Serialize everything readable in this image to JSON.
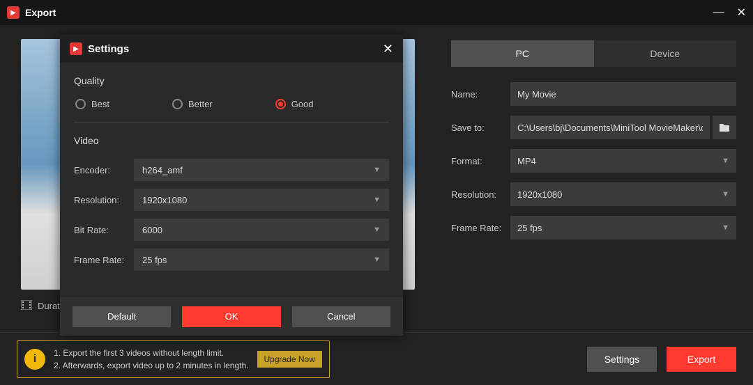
{
  "export_window": {
    "title": "Export",
    "tabs": {
      "pc": "PC",
      "device": "Device"
    },
    "fields": {
      "name_label": "Name:",
      "name_value": "My Movie",
      "save_to_label": "Save to:",
      "save_to_value": "C:\\Users\\bj\\Documents\\MiniTool MovieMaker\\outp",
      "format_label": "Format:",
      "format_value": "MP4",
      "resolution_label": "Resolution:",
      "resolution_value": "1920x1080",
      "framerate_label": "Frame Rate:",
      "framerate_value": "25 fps"
    },
    "duration_label": "Durat",
    "promo": {
      "line1": "1. Export the first 3 videos without length limit.",
      "line2": "2. Afterwards, export video up to 2 minutes in length.",
      "upgrade": "Upgrade Now"
    },
    "buttons": {
      "settings": "Settings",
      "export": "Export"
    }
  },
  "settings_modal": {
    "title": "Settings",
    "quality": {
      "heading": "Quality",
      "options": {
        "best": "Best",
        "better": "Better",
        "good": "Good"
      },
      "selected": "good"
    },
    "video": {
      "heading": "Video",
      "encoder_label": "Encoder:",
      "encoder_value": "h264_amf",
      "resolution_label": "Resolution:",
      "resolution_value": "1920x1080",
      "bitrate_label": "Bit Rate:",
      "bitrate_value": "6000",
      "framerate_label": "Frame Rate:",
      "framerate_value": "25 fps"
    },
    "buttons": {
      "default": "Default",
      "ok": "OK",
      "cancel": "Cancel"
    }
  }
}
